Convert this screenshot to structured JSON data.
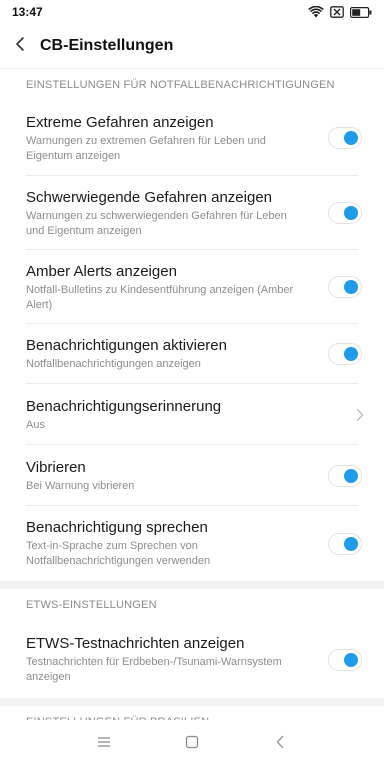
{
  "status_bar": {
    "time": "13:47",
    "icons": [
      "wifi-icon",
      "sim-disabled-icon",
      "battery-icon"
    ]
  },
  "header": {
    "title": "CB-Einstellungen",
    "back_icon": "back-arrow-icon"
  },
  "sections": [
    {
      "header": "EINSTELLUNGEN FÜR NOTFALLBENACHRICHTIGUNGEN",
      "items": [
        {
          "title": "Extreme Gefahren anzeigen",
          "subtitle": "Warnungen zu extremen Gefahren für Leben und Eigentum anzeigen",
          "control": "toggle",
          "checked": true
        },
        {
          "title": "Schwerwiegende Gefahren anzeigen",
          "subtitle": "Warnungen zu schwerwiegenden Gefahren für Leben und Eigentum anzeigen",
          "control": "toggle",
          "checked": true
        },
        {
          "title": "Amber Alerts anzeigen",
          "subtitle": "Notfall-Bulletins zu Kindesentführung anzeigen (Amber Alert)",
          "control": "toggle",
          "checked": true
        },
        {
          "title": "Benachrichtigungen aktivieren",
          "subtitle": "Notfallbenachrichtigungen anzeigen",
          "control": "toggle",
          "checked": true
        },
        {
          "title": "Benachrichtigungserinnerung",
          "subtitle": "Aus",
          "control": "chevron"
        },
        {
          "title": "Vibrieren",
          "subtitle": "Bei Warnung vibrieren",
          "control": "toggle",
          "checked": true
        },
        {
          "title": "Benachrichtigung sprechen",
          "subtitle": "Text-in-Sprache zum Sprechen von Notfallbenachrichtigungen verwenden",
          "control": "toggle",
          "checked": true
        }
      ]
    },
    {
      "header": "ETWS-EINSTELLUNGEN",
      "items": [
        {
          "title": "ETWS-Testnachrichten anzeigen",
          "subtitle": "Testnachrichten für Erdbeben-/Tsunami-Warnsystem anzeigen",
          "control": "toggle",
          "checked": true
        }
      ]
    },
    {
      "header": "EINSTELLUNGEN FÜR BRASILIEN",
      "items": []
    }
  ],
  "nav_bar": {
    "icons": [
      "menu-icon",
      "home-icon",
      "back-icon"
    ]
  },
  "colors": {
    "toggle_on": "#1e9ce9",
    "section_header": "#8a8a8a",
    "subtitle": "#8c8c8c"
  }
}
